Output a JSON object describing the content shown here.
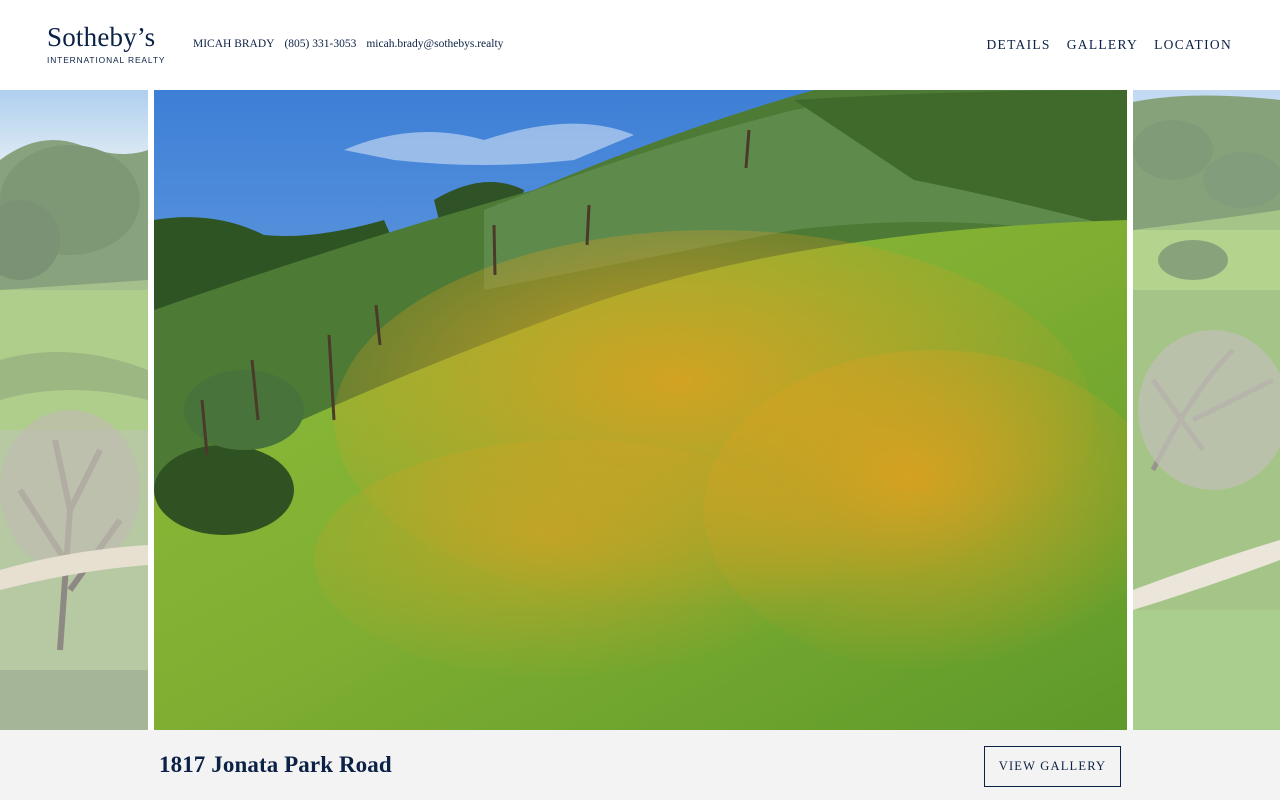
{
  "brand": {
    "name": "Sotheby’s",
    "tagline": "INTERNATIONAL REALTY"
  },
  "agent": {
    "name": "MICAH BRADY",
    "phone": "(805) 331-3053",
    "email": "micah.brady@sothebys.realty"
  },
  "nav": {
    "details": "DETAILS",
    "gallery": "GALLERY",
    "location": "LOCATION"
  },
  "listing": {
    "address": "1817 Jonata Park Road",
    "view_gallery_label": "VIEW GALLERY"
  },
  "colors": {
    "brand_navy": "#0b2145",
    "footer_bg": "#f3f3f3"
  }
}
